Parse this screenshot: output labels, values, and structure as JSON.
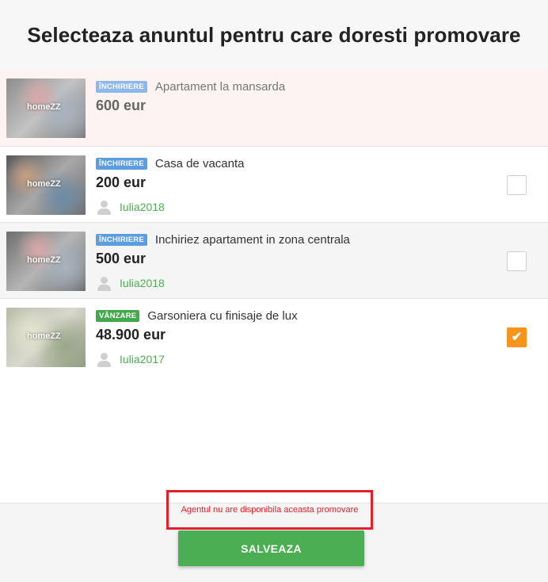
{
  "header": {
    "title": "Selecteaza anuntul pentru care doresti promovare"
  },
  "thumbnail": {
    "logo_text": "homeZZ"
  },
  "listings": [
    {
      "badge": "ÎNCHIRIERE",
      "title": "Apartament la mansarda",
      "price": "600 eur",
      "user": "",
      "checked": false
    },
    {
      "badge": "ÎNCHIRIERE",
      "title": "Casa de vacanta",
      "price": "200 eur",
      "user": "Iulia2018",
      "checked": false
    },
    {
      "badge": "ÎNCHIRIERE",
      "title": "Inchiriez apartament in zona centrala",
      "price": "500 eur",
      "user": "Iulia2018",
      "checked": false
    },
    {
      "badge": "VÂNZARE",
      "title": "Garsoniera cu finisaje de lux",
      "price": "48.900 eur",
      "user": "Iulia2017",
      "checked": true
    }
  ],
  "footer": {
    "warning": "Agentul nu are disponibila aceasta promovare",
    "save_label": "SALVEAZA"
  },
  "colors": {
    "accent_orange": "#f7941d",
    "green": "#4cae52",
    "warning_red": "#e0202a",
    "badge_rent": "#5a9ee0",
    "badge_sale": "#43a84a"
  }
}
